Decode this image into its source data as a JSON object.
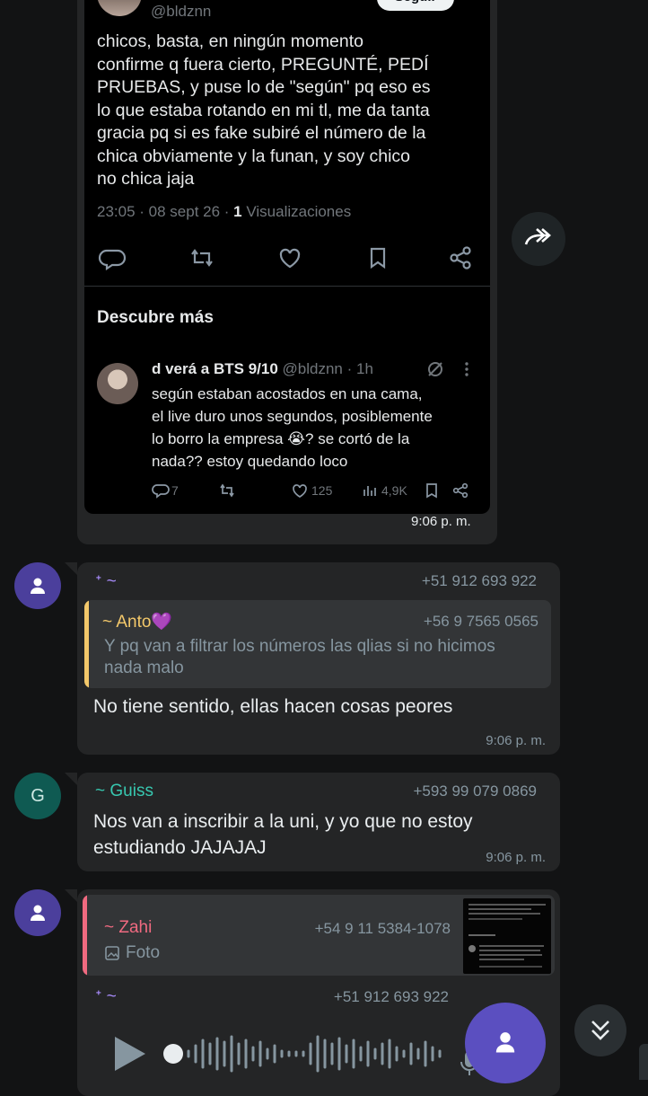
{
  "tweet": {
    "handle_top": "@bldznn",
    "follow_label": "Seguir",
    "body": "chicos, basta, en ningún momento\nconfirme q fuera cierto, PREGUNTÉ, PEDÍ\nPRUEBAS, y puse lo de \"según\" pq eso es\nlo que estaba rotando en mi tl, me da tanta\ngracia pq si es fake subiré el número de la\nchica obviamente y la funan, y soy chico\nno chica jaja",
    "meta_time": "23:05 · 08 sept 26 · ",
    "meta_views_count": "1",
    "meta_views_label": " Visualizaciones",
    "discover_title": "Descubre más",
    "related": {
      "name": "d verá a BTS 9/10",
      "handle_time": " @bldznn · 1h",
      "body": "según estaban acostados en una cama,\nel live duro unos segundos, posiblemente\nlo borro la empresa 😭? se cortó de la\nnada?? estoy quedando loco",
      "replies": "7",
      "likes": "125",
      "views": "4,9K"
    },
    "bubble_time": "9:06 p. m."
  },
  "messages": [
    {
      "sender": "ᕀ ~",
      "sender_color": "#a78bfa",
      "phone": "+51 912 693 922",
      "avatar_color": "#4b3f9c",
      "quote": {
        "sender": "~ Anto💜",
        "phone": "+56 9 7565 0565",
        "text": "Y pq van a filtrar los números las qlias si no hicimos\nnada malo",
        "bar_color": "#f3c86a"
      },
      "text": "No tiene sentido, ellas hacen cosas peores",
      "time": "9:06 p. m."
    },
    {
      "sender": "~ Guiss",
      "sender_color": "#37c8b0",
      "phone": "+593 99 079 0869",
      "avatar_letter": "G",
      "avatar_color": "#0f5a52",
      "text": "Nos van a inscribir a la uni, y yo que no estoy\nestudiando JAJAJAJ",
      "time": "9:06 p. m."
    },
    {
      "avatar_color": "#4b3f9c",
      "quote": {
        "sender": "~ Zahi",
        "phone": "+54 9 11 5384-1078",
        "text": "Foto",
        "bar_color": "#f06a80"
      },
      "sender": "ᕀ ~",
      "sender_color": "#a78bfa",
      "phone": "+51 912 693 922"
    }
  ],
  "icons": {
    "forward": "forward-icon",
    "scroll_down": "double-chevron-down-icon",
    "play": "play-icon",
    "mic": "mic-icon"
  }
}
